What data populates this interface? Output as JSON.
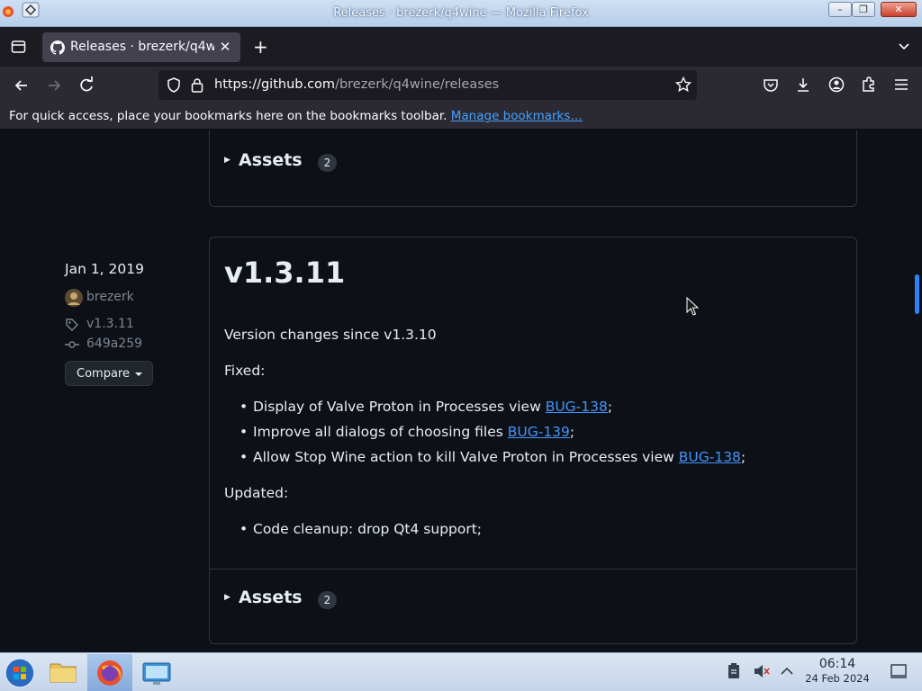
{
  "window": {
    "title": "Releases · brezerk/q4wine — Mozilla Firefox",
    "colors": {
      "titlebar": "#cfe0f4",
      "chrome": "#2b2a33",
      "page": "#0d1117",
      "link": "#4493f8"
    }
  },
  "tabs": [
    {
      "title": "Releases · brezerk/q4wine",
      "icon": "github-icon"
    }
  ],
  "navbar": {
    "url_host": "https://github.com",
    "url_path": "/brezerk/q4wine/releases"
  },
  "bookmarks_bar": {
    "message": "For quick access, place your bookmarks here on the bookmarks toolbar.",
    "link": "Manage bookmarks…"
  },
  "previous_release": {
    "assets_label": "Assets",
    "assets_count": "2"
  },
  "release": {
    "date": "Jan 1, 2019",
    "author": "brezerk",
    "tag": "v1.3.11",
    "commit": "649a259",
    "compare_label": "Compare",
    "title": "v1.3.11",
    "intro": "Version changes since v1.3.10",
    "fixed_heading": "Fixed:",
    "fixed_items": [
      {
        "text": "Display of Valve Proton in Processes view ",
        "link": "BUG-138",
        "suffix": ";"
      },
      {
        "text": "Improve all dialogs of choosing files ",
        "link": "BUG-139",
        "suffix": ";"
      },
      {
        "text": "Allow Stop Wine action to kill Valve Proton in Processes view ",
        "link": "BUG-138",
        "suffix": ";"
      }
    ],
    "updated_heading": "Updated:",
    "updated_items": [
      {
        "text": "Code cleanup: drop Qt4 support;"
      }
    ],
    "assets_label": "Assets",
    "assets_count": "2"
  },
  "taskbar": {
    "items": [
      "start-orb",
      "file-manager",
      "firefox",
      "control-panel"
    ],
    "time": "06:14",
    "date": "24 Feb 2024"
  }
}
